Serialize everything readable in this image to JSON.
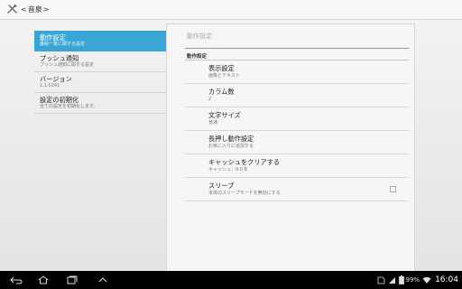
{
  "actionbar": {
    "up_title": "音泉",
    "app_icon": "tools-icon"
  },
  "categories": [
    {
      "title": "動作設定",
      "subtitle": "番組一覧に関する設定",
      "selected": true
    },
    {
      "title": "プッシュ通知",
      "subtitle": "プッシュ通知に関する設定",
      "selected": false
    },
    {
      "title": "バージョン",
      "subtitle": "1.1.0241",
      "selected": false
    },
    {
      "title": "設定の初期化",
      "subtitle": "全ての設定を初期化します。",
      "selected": false
    }
  ],
  "detail": {
    "title": "動作設定",
    "section_header": "動作設定",
    "prefs": [
      {
        "title": "表示設定",
        "summary": "画像とテキスト"
      },
      {
        "title": "カラム数",
        "summary": "2"
      },
      {
        "title": "文字サイズ",
        "summary": "普通"
      },
      {
        "title": "長押し動作設定",
        "summary": "お気に入りに追加する"
      },
      {
        "title": "キャッシュをクリアする",
        "summary": "キャッシュ：0.0 B"
      },
      {
        "title": "スリープ",
        "summary": "本体のスリープモードを無効にする",
        "checkbox": true,
        "checked": false
      }
    ]
  },
  "statusbar": {
    "battery_percent": "99%",
    "time": "16:04"
  },
  "colors": {
    "accent": "#3aa6d6",
    "background": "#eaeaea",
    "navbar": "#000000"
  }
}
